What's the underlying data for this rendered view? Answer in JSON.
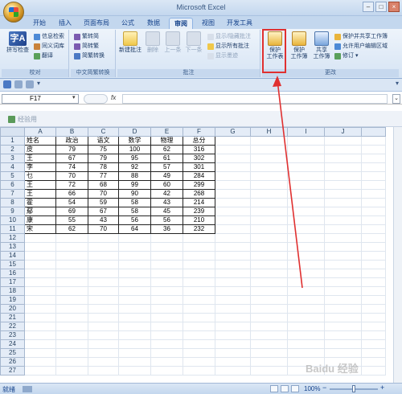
{
  "window": {
    "title": "Microsoft Excel"
  },
  "tabs": [
    "开始",
    "插入",
    "页面布局",
    "公式",
    "数据",
    "审阅",
    "视图",
    "开发工具"
  ],
  "active_tab": "审阅",
  "ribbon": {
    "proofing": {
      "label": "校对",
      "spell_check": "拼写检查",
      "research": "信息检索",
      "thesaurus": "同义词库",
      "translate": "翻译"
    },
    "chinese_conversion": {
      "label": "中文简繁转换",
      "to_simplified": "繁转简",
      "to_traditional": "简转繁",
      "conversion": "简繁转换"
    },
    "comments": {
      "label": "批注",
      "new_comment": "新建批注",
      "delete": "删除",
      "previous": "上一条",
      "next": "下一条",
      "show_hide": "显示/隐藏批注",
      "show_all": "显示所有批注",
      "show_ink": "显示墨迹"
    },
    "changes": {
      "label": "更改",
      "protect_sheet_line1": "保护",
      "protect_sheet_line2": "工作表",
      "protect_book_line1": "保护",
      "protect_book_line2": "工作簿",
      "share_line1": "共享",
      "share_line2": "工作簿",
      "protect_share": "保护并共享工作簿",
      "allow_edit": "允许用户编辑区域",
      "track_changes": "修订"
    }
  },
  "formula_bar": {
    "name_box": "F17",
    "fx": "fx",
    "formula": ""
  },
  "document": {
    "title": "经验用"
  },
  "columns": [
    "A",
    "B",
    "C",
    "D",
    "E",
    "F",
    "G",
    "H",
    "I",
    "J"
  ],
  "row_count": 27,
  "table": {
    "headers": [
      "姓名",
      "政治",
      "语文",
      "数学",
      "物理",
      "总分"
    ],
    "rows": [
      [
        "皮",
        "79",
        "75",
        "100",
        "62",
        "316"
      ],
      [
        "王",
        "67",
        "79",
        "95",
        "61",
        "302"
      ],
      [
        "李",
        "74",
        "78",
        "92",
        "57",
        "301"
      ],
      [
        "乜",
        "70",
        "77",
        "88",
        "49",
        "284"
      ],
      [
        "王",
        "72",
        "68",
        "99",
        "60",
        "299"
      ],
      [
        "王",
        "66",
        "70",
        "90",
        "42",
        "268"
      ],
      [
        "霍",
        "54",
        "59",
        "58",
        "43",
        "214"
      ],
      [
        "鄢",
        "69",
        "67",
        "58",
        "45",
        "239"
      ],
      [
        "康",
        "55",
        "43",
        "56",
        "56",
        "210"
      ],
      [
        "宋",
        "62",
        "70",
        "64",
        "36",
        "232"
      ]
    ]
  },
  "status": {
    "ready": "就绪",
    "zoom": "100%"
  },
  "watermark": "Baidu 经验",
  "colors": {
    "highlight": "#e03030",
    "ribbon_bg": "#dae6f4"
  }
}
